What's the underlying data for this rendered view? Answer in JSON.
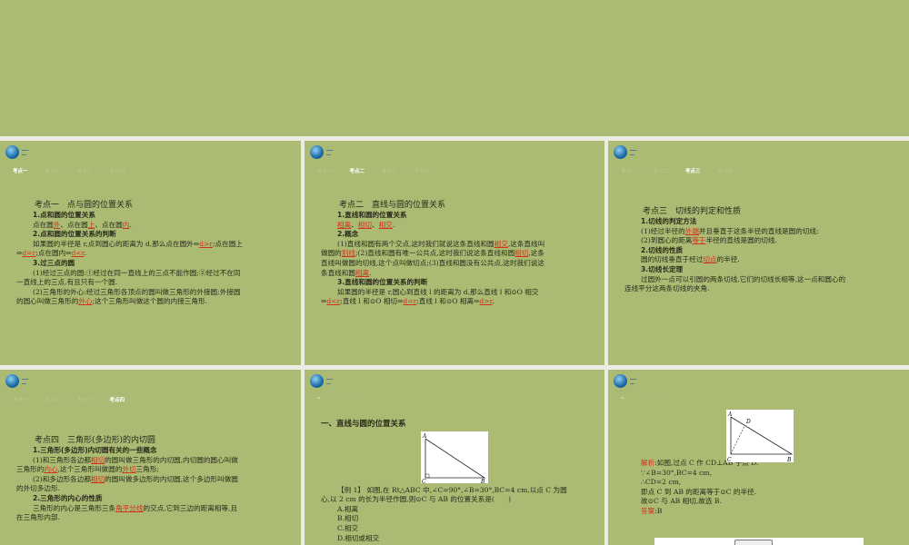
{
  "logo": {
    "mark": "2e"
  },
  "nav": [
    "考点一",
    "考点二",
    "考点三",
    "考点四"
  ],
  "slides": [
    {
      "active": 0,
      "lines": [
        {
          "c": "title",
          "s": [
            {
              "t": "考点一　点与圆的位置关系"
            }
          ]
        },
        {
          "c": "h",
          "s": [
            {
              "t": "1.点和圆的位置关系"
            }
          ]
        },
        {
          "c": "i",
          "s": [
            {
              "t": "点在圆"
            },
            {
              "t": "外",
              "hl": 1
            },
            {
              "t": "、点在圆"
            },
            {
              "t": "上",
              "hl": 1
            },
            {
              "t": "、点在圆"
            },
            {
              "t": "内",
              "hl": 1
            },
            {
              "t": "."
            }
          ]
        },
        {
          "c": "h",
          "s": [
            {
              "t": "2.点和圆的位置关系的判断"
            }
          ]
        },
        {
          "c": "i",
          "s": [
            {
              "t": "如果圆的半径是 r,点到圆心的距离为 d,那么点在圆外⇔"
            },
            {
              "t": "d>r",
              "hl": 1
            },
            {
              "t": ";点在圆上"
            }
          ]
        },
        {
          "c": "p",
          "s": [
            {
              "t": "⇔"
            },
            {
              "t": "d=r",
              "hl": 1
            },
            {
              "t": ";点在圆内⇔"
            },
            {
              "t": "d<r",
              "hl": 1
            },
            {
              "t": "."
            }
          ]
        },
        {
          "c": "h",
          "s": [
            {
              "t": "3.过三点的圆"
            }
          ]
        },
        {
          "c": "i",
          "s": [
            {
              "t": "(1)经过三点的圆:①经过在同一直线上的三点不能作圆;②经过不在同"
            }
          ]
        },
        {
          "c": "p",
          "s": [
            {
              "t": "一直线上的三点,有且只有一个圆."
            }
          ]
        },
        {
          "c": "i",
          "s": [
            {
              "t": "(2)三角形的外心:经过三角形各顶点的圆叫做三角形的外接圆;外接圆"
            }
          ]
        },
        {
          "c": "p",
          "s": [
            {
              "t": "的圆心叫做三角形的"
            },
            {
              "t": "外心",
              "hl": 1
            },
            {
              "t": ";这个三角形叫做这个圆的内接三角形."
            }
          ]
        }
      ]
    },
    {
      "active": 1,
      "lines": [
        {
          "c": "title",
          "s": [
            {
              "t": "考点二　直线与圆的位置关系"
            }
          ]
        },
        {
          "c": "h",
          "s": [
            {
              "t": "1.直线和圆的位置关系"
            }
          ]
        },
        {
          "c": "i",
          "s": [
            {
              "t": "相离",
              "hl": 1
            },
            {
              "t": "、"
            },
            {
              "t": "相切",
              "hl": 1
            },
            {
              "t": "、"
            },
            {
              "t": "相交",
              "hl": 1
            },
            {
              "t": "."
            }
          ]
        },
        {
          "c": "h",
          "s": [
            {
              "t": "2.概念"
            }
          ]
        },
        {
          "c": "i",
          "s": [
            {
              "t": "(1)直线和圆有两个交点,这时我们就说这条直线和圆"
            },
            {
              "t": "相交",
              "hl": 1
            },
            {
              "t": ",这条直线叫"
            }
          ]
        },
        {
          "c": "p",
          "s": [
            {
              "t": "做圆的"
            },
            {
              "t": "割线",
              "hl": 1
            },
            {
              "t": ";(2)直线和圆有唯一公共点,这时我们说这条直线和圆"
            },
            {
              "t": "相切",
              "hl": 1
            },
            {
              "t": ",这条"
            }
          ]
        },
        {
          "c": "p",
          "s": [
            {
              "t": "直线叫做圆的切线,这个点叫做切点;(3)直线和圆没有公共点,这时我们说这"
            }
          ]
        },
        {
          "c": "p",
          "s": [
            {
              "t": "条直线和圆"
            },
            {
              "t": "相离",
              "hl": 1
            },
            {
              "t": "."
            }
          ]
        },
        {
          "c": "h",
          "s": [
            {
              "t": "3.直线和圆的位置关系的判断"
            }
          ]
        },
        {
          "c": "i",
          "s": [
            {
              "t": "如果圆的半径是 r,圆心到直线 l 的距离为 d,那么直线 l 和⊙O 相交"
            }
          ]
        },
        {
          "c": "p",
          "s": [
            {
              "t": "⇔"
            },
            {
              "t": "d<r",
              "hl": 1
            },
            {
              "t": ";直线 l 和⊙O 相切⇔"
            },
            {
              "t": "d=r",
              "hl": 1
            },
            {
              "t": ";直线 l 和⊙O 相离⇔"
            },
            {
              "t": "d>r",
              "hl": 1
            },
            {
              "t": "."
            }
          ]
        }
      ]
    },
    {
      "active": 2,
      "lines": [
        {
          "c": "title",
          "s": [
            {
              "t": "考点三　切线的判定和性质"
            }
          ]
        },
        {
          "c": "h",
          "s": [
            {
              "t": "1.切线的判定方法"
            }
          ]
        },
        {
          "c": "i",
          "s": [
            {
              "t": "(1)经过半径的"
            },
            {
              "t": "外端",
              "hl": 1
            },
            {
              "t": "并且垂直于这条半径的直线是圆的切线;"
            }
          ]
        },
        {
          "c": "i",
          "s": [
            {
              "t": "(2)到圆心的距离"
            },
            {
              "t": "等于",
              "hl": 1
            },
            {
              "t": "半径的直线是圆的切线."
            }
          ]
        },
        {
          "c": "h",
          "s": [
            {
              "t": "2.切线的性质"
            }
          ]
        },
        {
          "c": "i",
          "s": [
            {
              "t": "圆的切线垂直于经过"
            },
            {
              "t": "切点",
              "hl": 1
            },
            {
              "t": "的半径."
            }
          ]
        },
        {
          "c": "h",
          "s": [
            {
              "t": "3.切线长定理"
            }
          ]
        },
        {
          "c": "i",
          "s": [
            {
              "t": "过圆外一点可以引圆的两条切线,它们的切线长相等,这一点和圆心的"
            }
          ]
        },
        {
          "c": "p",
          "s": [
            {
              "t": "连线平分这两条切线的夹角."
            }
          ]
        }
      ]
    },
    {
      "active": 3,
      "lines": [
        {
          "c": "title",
          "s": [
            {
              "t": "考点四　三角形(多边形)的内切圆"
            }
          ]
        },
        {
          "c": "h",
          "s": [
            {
              "t": "1.三角形(多边形)内切圆有关的一些概念"
            }
          ]
        },
        {
          "c": "i",
          "s": [
            {
              "t": "(1)和三角形各边都"
            },
            {
              "t": "相切",
              "hl": 1
            },
            {
              "t": "的圆叫做三角形的内切圆,内切圆的圆心叫做"
            }
          ]
        },
        {
          "c": "p",
          "s": [
            {
              "t": "三角形的"
            },
            {
              "t": "内心",
              "hl": 1
            },
            {
              "t": ",这个三角形叫做圆的"
            },
            {
              "t": "外切",
              "hl": 1
            },
            {
              "t": "三角形;"
            }
          ]
        },
        {
          "c": "i",
          "s": [
            {
              "t": "(2)和多边形各边都"
            },
            {
              "t": "相切",
              "hl": 1
            },
            {
              "t": "的圆叫做多边形的内切圆,这个多边形叫做圆"
            }
          ]
        },
        {
          "c": "p",
          "s": [
            {
              "t": "的外切多边形."
            }
          ]
        },
        {
          "c": "h",
          "s": [
            {
              "t": "2.三角形的内心的性质"
            }
          ]
        },
        {
          "c": "i",
          "s": [
            {
              "t": "三角形的内心是三角形三条"
            },
            {
              "t": "角平分线",
              "hl": 1
            },
            {
              "t": "的交点,它到三边的距离相等,且"
            }
          ]
        },
        {
          "c": "p",
          "s": [
            {
              "t": "在三角形内部."
            }
          ]
        }
      ]
    },
    {
      "active": -1,
      "lines": [
        {
          "c": "title2",
          "s": [
            {
              "t": "一、直线与圆的位置关系"
            }
          ]
        },
        {
          "c": "i",
          "s": [
            {
              "t": "【例 1】 如图,在 Rt△ABC 中,∠C=90°,∠B=30°,BC=4 cm,以点 C 为圆"
            }
          ]
        },
        {
          "c": "p",
          "s": [
            {
              "t": "心,以 2 cm 的长为半径作圆,则⊙C 与 AB 的位置关系是(　　)"
            }
          ]
        },
        {
          "c": "i",
          "s": [
            {
              "t": "A.相离"
            }
          ]
        },
        {
          "c": "i",
          "s": [
            {
              "t": "B.相切"
            }
          ]
        },
        {
          "c": "i",
          "s": [
            {
              "t": "C.相交"
            }
          ]
        },
        {
          "c": "i",
          "s": [
            {
              "t": "D.相切或相交"
            }
          ]
        }
      ]
    },
    {
      "active": -1,
      "lines": [
        {
          "c": "i",
          "s": [
            {
              "t": "解析",
              "red": 1
            },
            {
              "t": ":如图,过点 C 作 CD⊥AB 于点 D."
            }
          ]
        },
        {
          "c": "i",
          "s": [
            {
              "t": "∵∠B=30°,BC=4 cm,"
            }
          ]
        },
        {
          "c": "i",
          "s": [
            {
              "t": "∴CD=2 cm,"
            }
          ]
        },
        {
          "c": "i",
          "s": [
            {
              "t": "即点 C 到 AB 的距离等于⊙C 的半径."
            }
          ]
        },
        {
          "c": "i",
          "s": [
            {
              "t": "故⊙C 与 AB 相切,故选 B."
            }
          ]
        },
        {
          "c": "i",
          "s": [
            {
              "t": "答案",
              "red": 1
            },
            {
              "t": ":B"
            }
          ]
        }
      ]
    }
  ],
  "figure": {
    "A": "A",
    "B": "B",
    "C": "C",
    "D": "D"
  },
  "colors": {
    "slide_bg": "#abbb74",
    "highlight": "#d2321c"
  }
}
